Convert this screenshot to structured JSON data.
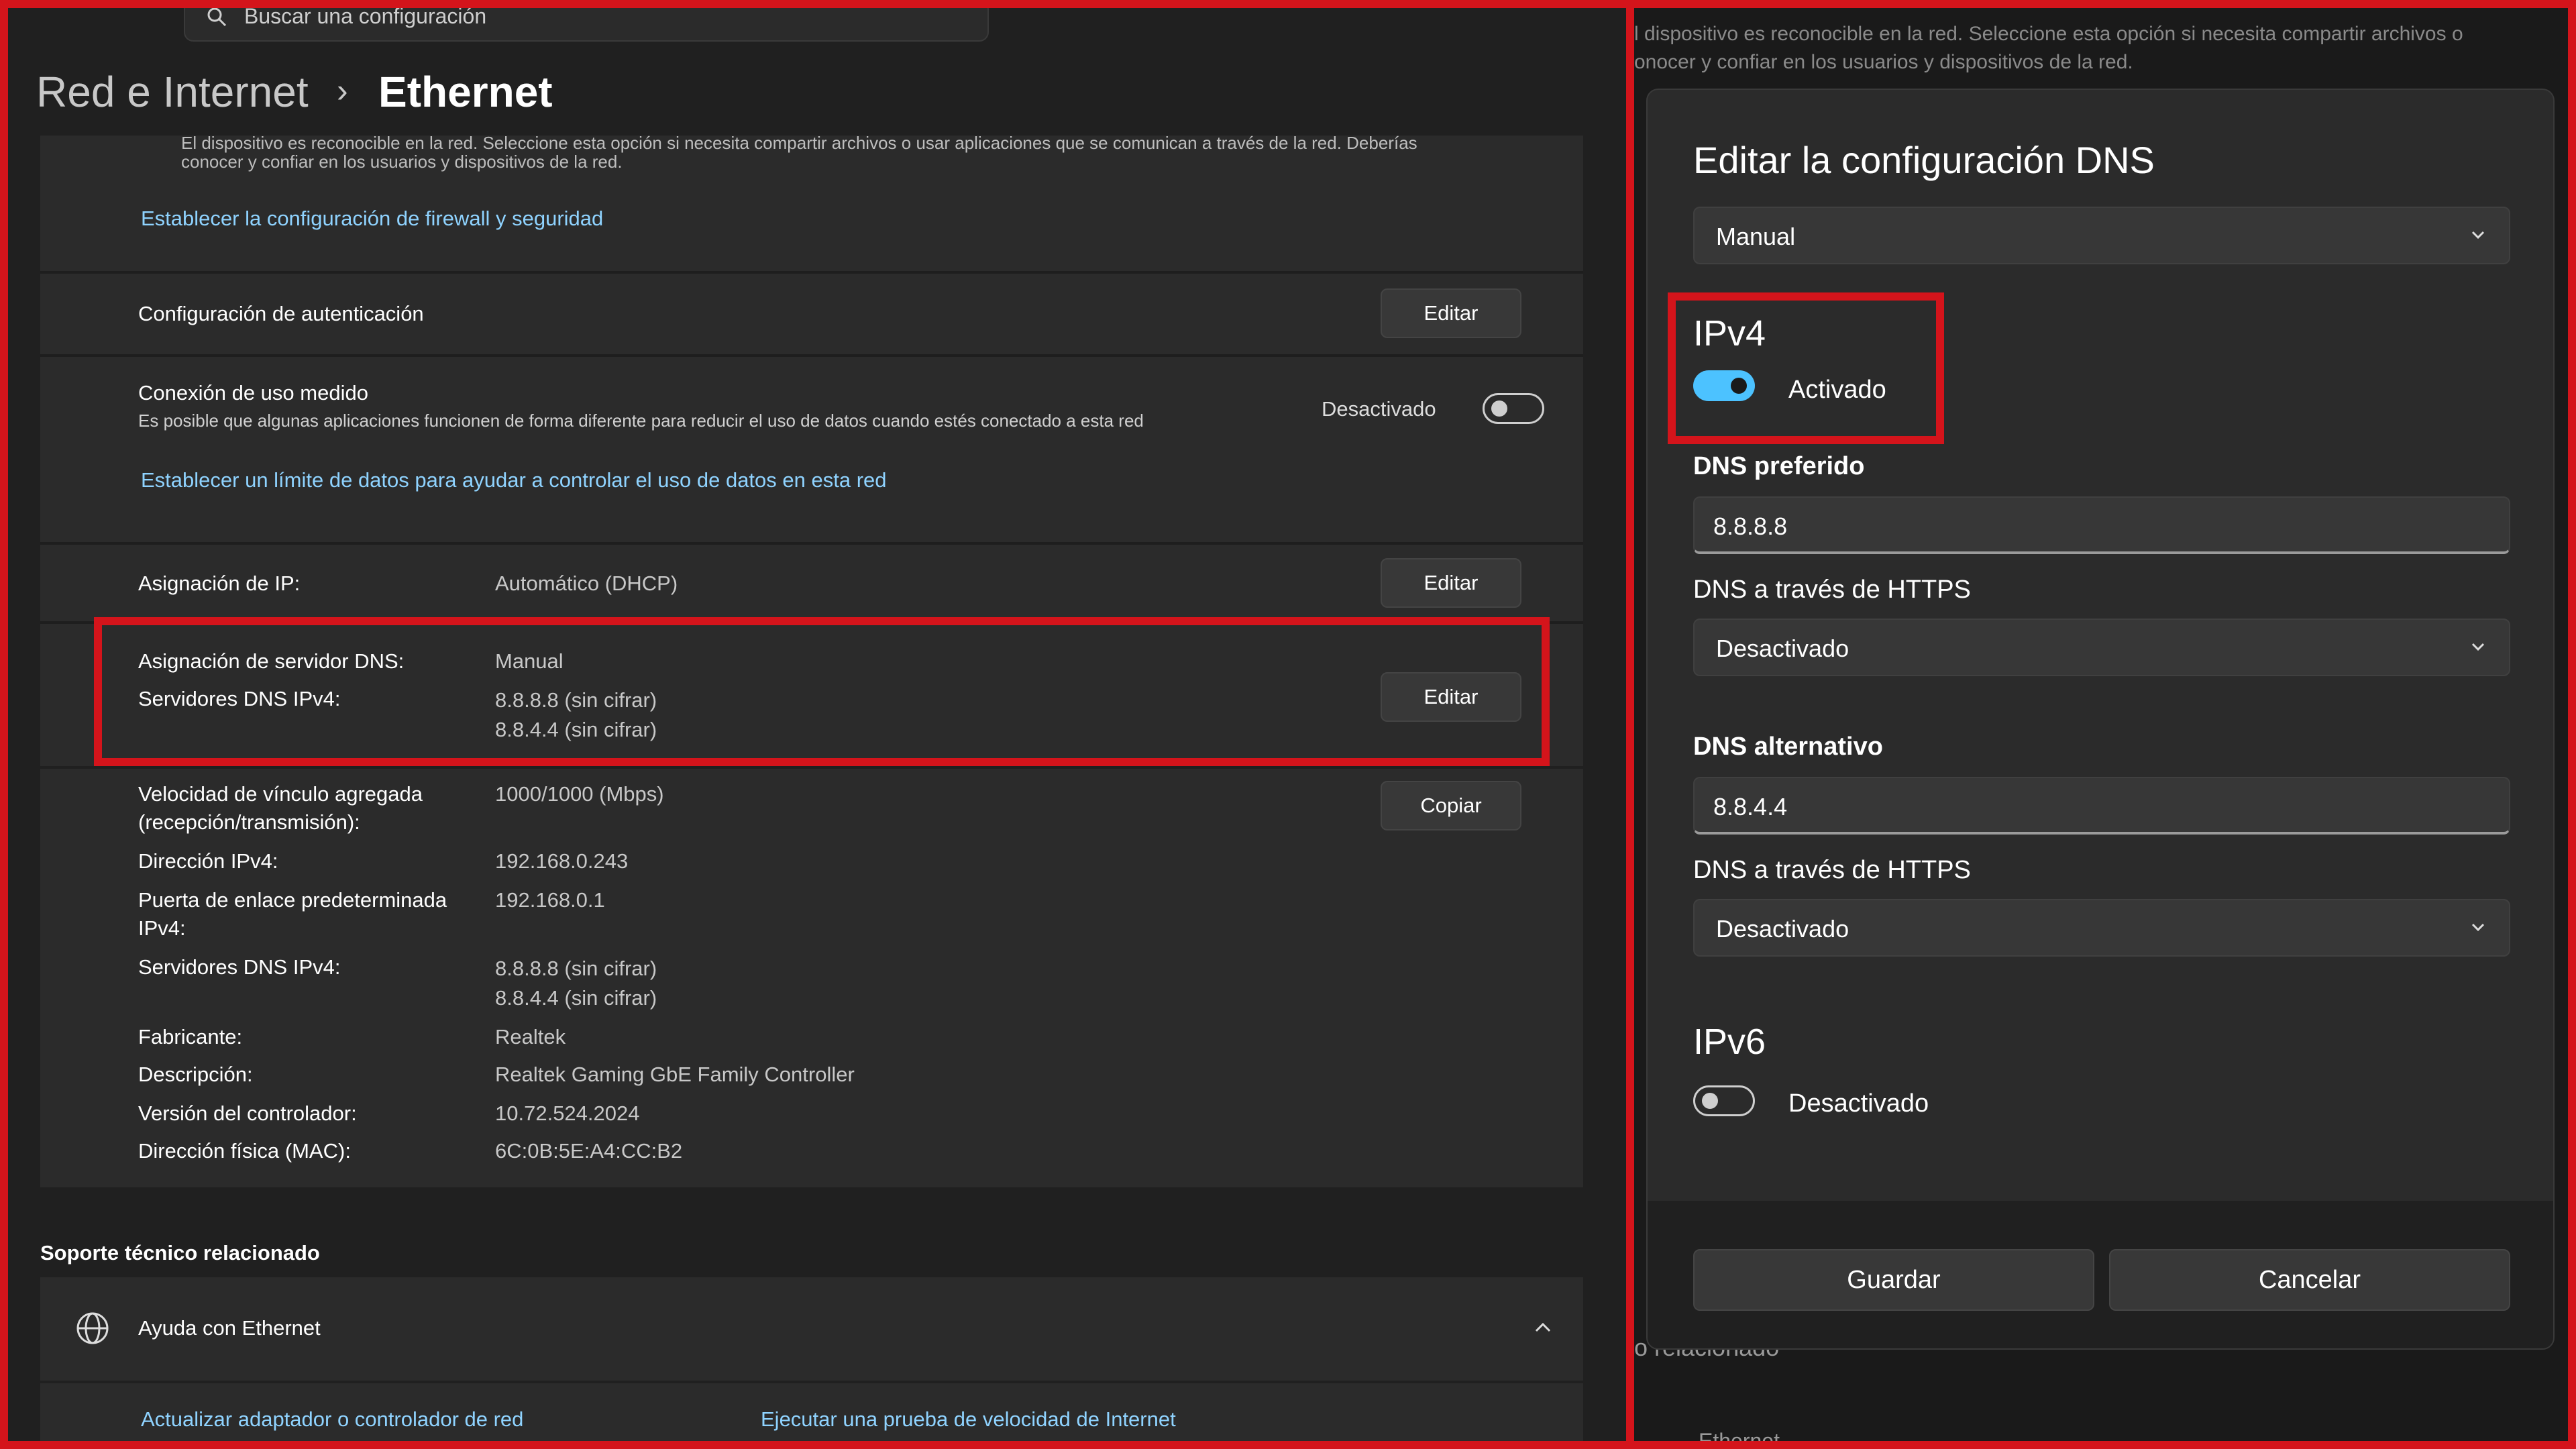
{
  "search": {
    "placeholder": "Buscar una configuración"
  },
  "breadcrumb": {
    "parent": "Red e Internet",
    "separator": "›",
    "current": "Ethernet"
  },
  "network_profile": {
    "desc_line1": "El dispositivo es reconocible en la red. Seleccione esta opción si necesita compartir archivos o usar aplicaciones que se comunican a través de la red. Deberías",
    "desc_line2": "conocer y confiar en los usuarios y dispositivos de la red.",
    "firewall_link": "Establecer la configuración de firewall y seguridad"
  },
  "auth": {
    "label": "Configuración de autenticación",
    "button": "Editar"
  },
  "metered": {
    "label": "Conexión de uso medido",
    "description": "Es posible que algunas aplicaciones funcionen de forma diferente para reducir el uso de datos cuando estés conectado a esta red",
    "state": "Desactivado",
    "link": "Establecer un límite de datos para ayudar a controlar el uso de datos en esta red"
  },
  "ip_assignment": {
    "label": "Asignación de IP:",
    "value": "Automático (DHCP)",
    "button": "Editar"
  },
  "dns_assignment": {
    "label": "Asignación de servidor DNS:",
    "value": "Manual",
    "servers_label": "Servidores DNS IPv4:",
    "server1": "8.8.8.8 (sin cifrar)",
    "server2": "8.8.4.4 (sin cifrar)",
    "button": "Editar"
  },
  "properties": {
    "copy_button": "Copiar",
    "rows": [
      {
        "label1": "Velocidad de vínculo agregada",
        "label2": "(recepción/transmisión):",
        "value1": "1000/1000 (Mbps)",
        "value2": ""
      },
      {
        "label1": "Dirección IPv4:",
        "label2": "",
        "value1": "192.168.0.243",
        "value2": ""
      },
      {
        "label1": "Puerta de enlace predeterminada",
        "label2": "IPv4:",
        "value1": "192.168.0.1",
        "value2": ""
      },
      {
        "label1": "Servidores DNS IPv4:",
        "label2": "",
        "value1": "8.8.8.8 (sin cifrar)",
        "value2": "8.8.4.4 (sin cifrar)"
      },
      {
        "label1": "Fabricante:",
        "label2": "",
        "value1": "Realtek",
        "value2": ""
      },
      {
        "label1": "Descripción:",
        "label2": "",
        "value1": "Realtek Gaming GbE Family Controller",
        "value2": ""
      },
      {
        "label1": "Versión del controlador:",
        "label2": "",
        "value1": "10.72.524.2024",
        "value2": ""
      },
      {
        "label1": "Dirección física (MAC):",
        "label2": "",
        "value1": "6C:0B:5E:A4:CC:B2",
        "value2": ""
      }
    ]
  },
  "support": {
    "heading": "Soporte técnico relacionado",
    "help_label": "Ayuda con Ethernet",
    "link1": "Actualizar adaptador o controlador de red",
    "link2": "Ejecutar una prueba de velocidad de Internet"
  },
  "background_right": {
    "line1": "l dispositivo es reconocible en la red. Seleccione esta opción si necesita compartir archivos o",
    "line2": "onocer y confiar en los usuarios y dispositivos de la red.",
    "bottom_text": "o relacionado",
    "bottom_text2": "Ethernet"
  },
  "dialog": {
    "title": "Editar la configuración DNS",
    "mode": "Manual",
    "ipv4": {
      "heading": "IPv4",
      "toggle_label": "Activado",
      "toggle_on": true
    },
    "preferred_label": "DNS preferido",
    "preferred_value": "8.8.8.8",
    "https_label_1": "DNS a través de HTTPS",
    "https_value_1": "Desactivado",
    "alternate_label": "DNS alternativo",
    "alternate_value": "8.8.4.4",
    "https_label_2": "DNS a través de HTTPS",
    "https_value_2": "Desactivado",
    "ipv6": {
      "heading": "IPv6",
      "toggle_label": "Desactivado",
      "toggle_on": false
    },
    "save": "Guardar",
    "cancel": "Cancelar"
  },
  "colors": {
    "highlight": "#d4141b",
    "accent": "#4cc2ff",
    "link": "#8fd3ff"
  }
}
